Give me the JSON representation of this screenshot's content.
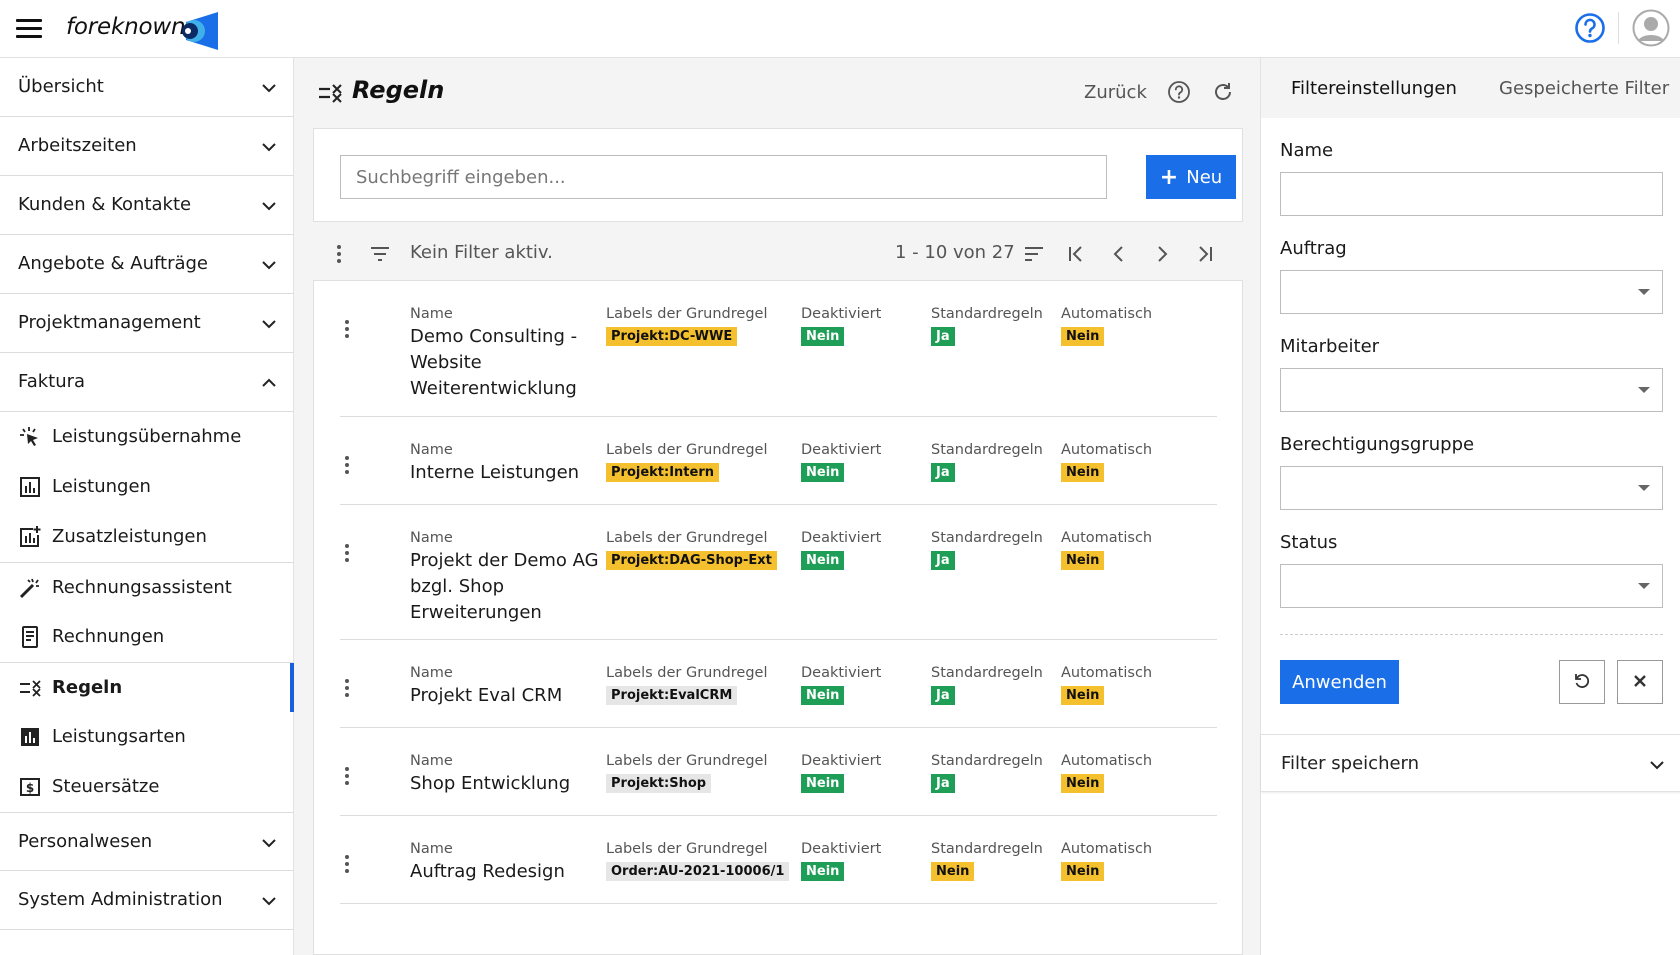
{
  "app": {
    "logo_text": "foreknown",
    "colors": {
      "accent": "#1a6fe8",
      "badge_yellow": "#f5c02e",
      "badge_green": "#1f9e57",
      "badge_gray": "#e6e6e6",
      "active_bar": "#1a5fdc"
    }
  },
  "topbar": {
    "menu_icon": "hamburger-icon",
    "help_icon": "question-circle-icon",
    "avatar_icon": "user-avatar-icon"
  },
  "sidebar": {
    "groups_top": [
      {
        "label": "Übersicht",
        "expanded": false
      },
      {
        "label": "Arbeitszeiten",
        "expanded": false
      },
      {
        "label": "Kunden & Kontakte",
        "expanded": false
      },
      {
        "label": "Angebote & Aufträge",
        "expanded": false
      },
      {
        "label": "Projektmanagement",
        "expanded": false
      },
      {
        "label": "Faktura",
        "expanded": true
      }
    ],
    "faktura_items": [
      {
        "label": "Leistungsübernahme",
        "icon": "sparkle-cursor-icon"
      },
      {
        "label": "Leistungen",
        "icon": "bar-chart-box-icon"
      },
      {
        "label": "Zusatzleistungen",
        "icon": "bar-chart-plus-icon"
      },
      {
        "label": "Rechnungsassistent",
        "icon": "magic-wand-icon"
      },
      {
        "label": "Rechnungen",
        "icon": "invoice-icon"
      },
      {
        "label": "Regeln",
        "icon": "rules-icon",
        "active": true
      },
      {
        "label": "Leistungsarten",
        "icon": "bar-chart-solid-icon"
      },
      {
        "label": "Steuersätze",
        "icon": "dollar-box-icon"
      }
    ],
    "groups_bottom": [
      {
        "label": "Personalwesen",
        "expanded": false
      },
      {
        "label": "System Administration",
        "expanded": false
      }
    ]
  },
  "main": {
    "title": "Regeln",
    "back_label": "Zurück",
    "search": {
      "placeholder": "Suchbegriff eingeben...",
      "value": ""
    },
    "new_button": "Neu",
    "filter_status": "Kein Filter aktiv.",
    "pager": "1 - 10 von 27",
    "columns": {
      "name": "Name",
      "labels": "Labels der Grundregel",
      "deactivated": "Deaktiviert",
      "standard": "Standardregeln",
      "automatic": "Automatisch"
    },
    "rows": [
      {
        "name": "Demo Consulting - Website Weiterentwicklung",
        "label": "Projekt:DC-WWE",
        "label_style": "yellow",
        "deactivated": "Nein",
        "standard": "Ja",
        "standard_style": "green",
        "automatic": "Nein"
      },
      {
        "name": "Interne Leistungen",
        "label": "Projekt:Intern",
        "label_style": "yellow",
        "deactivated": "Nein",
        "standard": "Ja",
        "standard_style": "green",
        "automatic": "Nein"
      },
      {
        "name": "Projekt der Demo AG bzgl. Shop Erweiterungen",
        "label": "Projekt:DAG-Shop-Ext",
        "label_style": "yellow",
        "deactivated": "Nein",
        "standard": "Ja",
        "standard_style": "green",
        "automatic": "Nein"
      },
      {
        "name": "Projekt Eval CRM",
        "label": "Projekt:EvalCRM",
        "label_style": "gray",
        "deactivated": "Nein",
        "standard": "Ja",
        "standard_style": "green",
        "automatic": "Nein"
      },
      {
        "name": "Shop Entwicklung",
        "label": "Projekt:Shop",
        "label_style": "gray",
        "deactivated": "Nein",
        "standard": "Ja",
        "standard_style": "green",
        "automatic": "Nein"
      },
      {
        "name": "Auftrag Redesign",
        "label": "Order:AU-2021-10006/1",
        "label_style": "gray",
        "deactivated": "Nein",
        "standard": "Nein",
        "standard_style": "yellow",
        "automatic": "Nein"
      }
    ]
  },
  "filter_panel": {
    "tab_settings": "Filtereinstellungen",
    "tab_saved": "Gespeicherte Filter",
    "name_label": "Name",
    "name_value": "",
    "auftrag_label": "Auftrag",
    "mitarbeiter_label": "Mitarbeiter",
    "gruppe_label": "Berechtigungsgruppe",
    "status_label": "Status",
    "apply_button": "Anwenden",
    "save_filter": "Filter speichern"
  }
}
